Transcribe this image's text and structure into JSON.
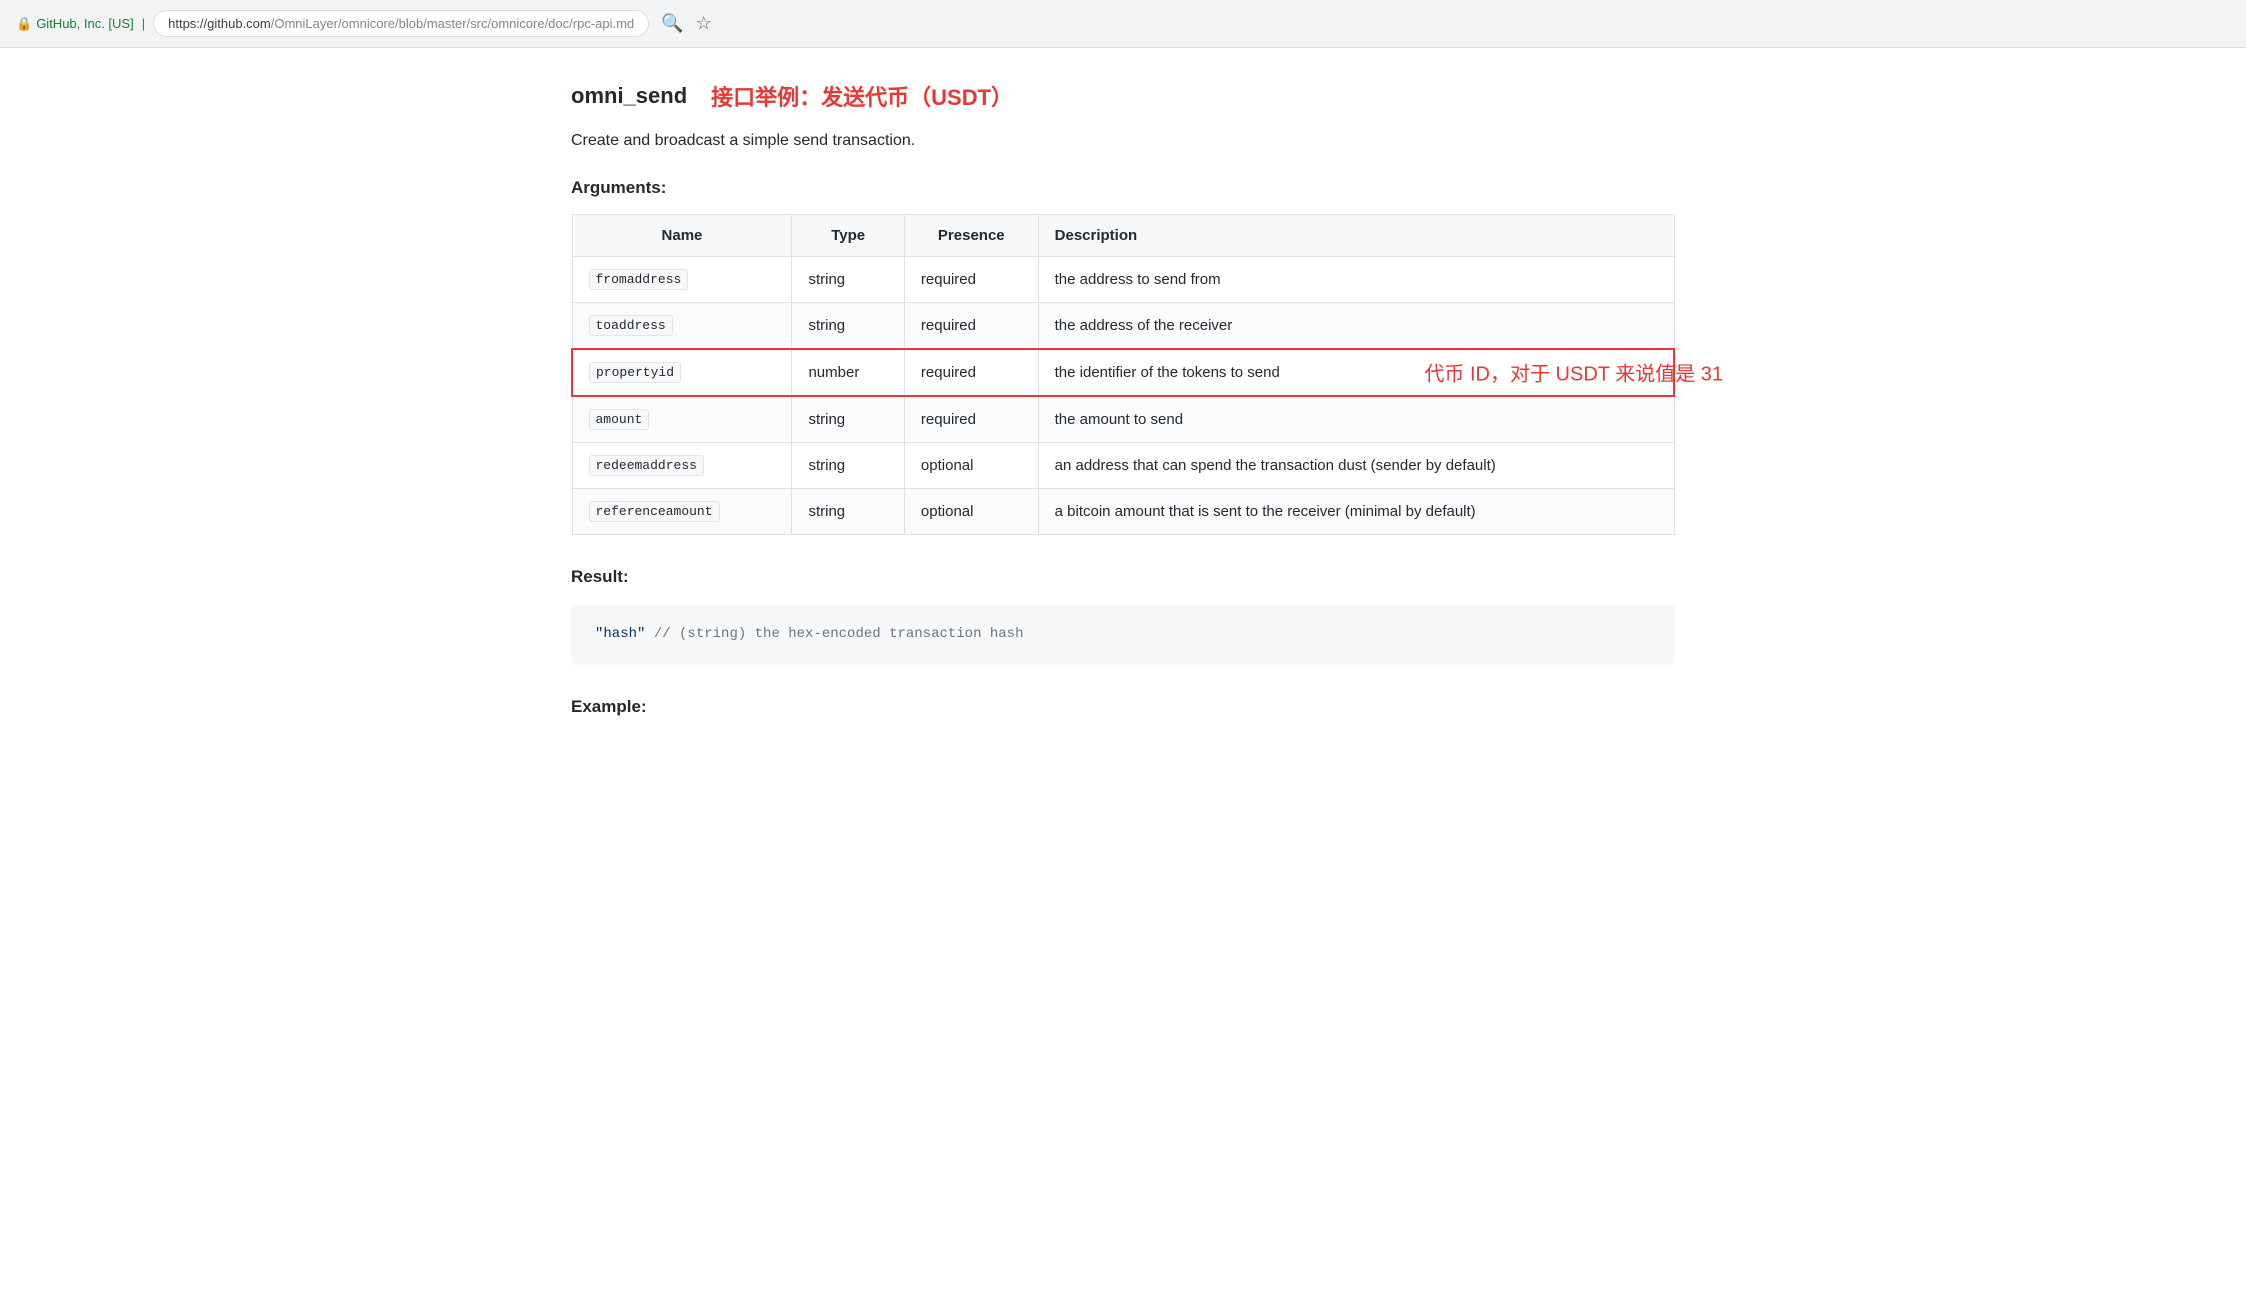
{
  "browser": {
    "security_label": "GitHub, Inc. [US]",
    "url_domain": "https://github.com",
    "url_path": "/OmniLayer/omnicore/blob/master/src/omnicore/doc/rpc-api.md",
    "search_icon": "🔍",
    "star_icon": "☆"
  },
  "page": {
    "api_name": "omni_send",
    "api_subtitle": "接口举例：发送代币（USDT）",
    "description": "Create and broadcast a simple send transaction.",
    "arguments_title": "Arguments:",
    "result_title": "Result:",
    "example_title": "Example:",
    "table": {
      "headers": [
        "Name",
        "Type",
        "Presence",
        "Description"
      ],
      "rows": [
        {
          "name": "fromaddress",
          "type": "string",
          "presence": "required",
          "description": "the address to send from",
          "highlighted": false
        },
        {
          "name": "toaddress",
          "type": "string",
          "presence": "required",
          "description": "the address of the receiver",
          "highlighted": false
        },
        {
          "name": "propertyid",
          "type": "number",
          "presence": "required",
          "description": "the identifier of the tokens to send",
          "highlighted": true,
          "annotation": "代币 ID，对于 USDT 来说值是 31"
        },
        {
          "name": "amount",
          "type": "string",
          "presence": "required",
          "description": "the amount to send",
          "highlighted": false
        },
        {
          "name": "redeemaddress",
          "type": "string",
          "presence": "optional",
          "description": "an address that can spend the transaction dust (sender by default)",
          "highlighted": false
        },
        {
          "name": "referenceamount",
          "type": "string",
          "presence": "optional",
          "description": "a bitcoin amount that is sent to the receiver (minimal by default)",
          "highlighted": false
        }
      ]
    },
    "result_code": "\"hash\"  // (string) the hex-encoded transaction hash"
  }
}
